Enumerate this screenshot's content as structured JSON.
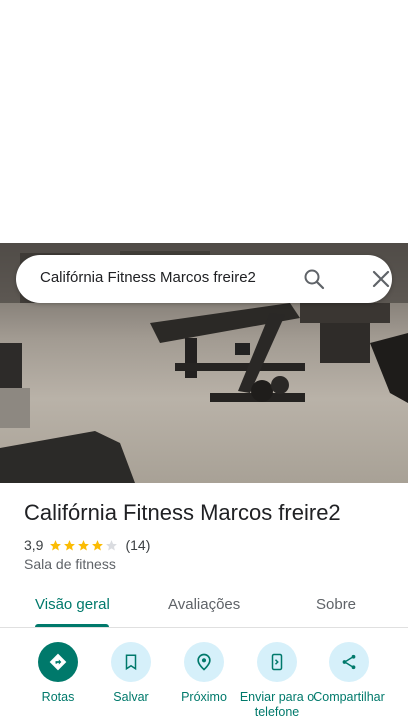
{
  "search": {
    "query": "Califórnia Fitness Marcos freire2",
    "search_icon": "search-icon",
    "close_icon": "close-icon"
  },
  "place": {
    "name": "Califórnia Fitness Marcos freire2",
    "rating": "3,9",
    "rating_stars": 3.9,
    "review_count": "(14)",
    "category": "Sala de fitness"
  },
  "tabs": [
    {
      "label": "Visão geral",
      "active": true
    },
    {
      "label": "Avaliações",
      "active": false
    },
    {
      "label": "Sobre",
      "active": false
    }
  ],
  "actions": [
    {
      "label": "Rotas",
      "icon": "directions-icon"
    },
    {
      "label": "Salvar",
      "icon": "bookmark-icon"
    },
    {
      "label": "Próximo",
      "icon": "nearby-icon"
    },
    {
      "label": "Enviar para o telefone",
      "icon": "send-to-phone-icon"
    },
    {
      "label": "Compartilhar",
      "icon": "share-icon"
    }
  ],
  "colors": {
    "accent": "#00796b",
    "action_bg": "#d6f0fa",
    "star": "#fbbc04",
    "star_empty": "#dadce0"
  }
}
